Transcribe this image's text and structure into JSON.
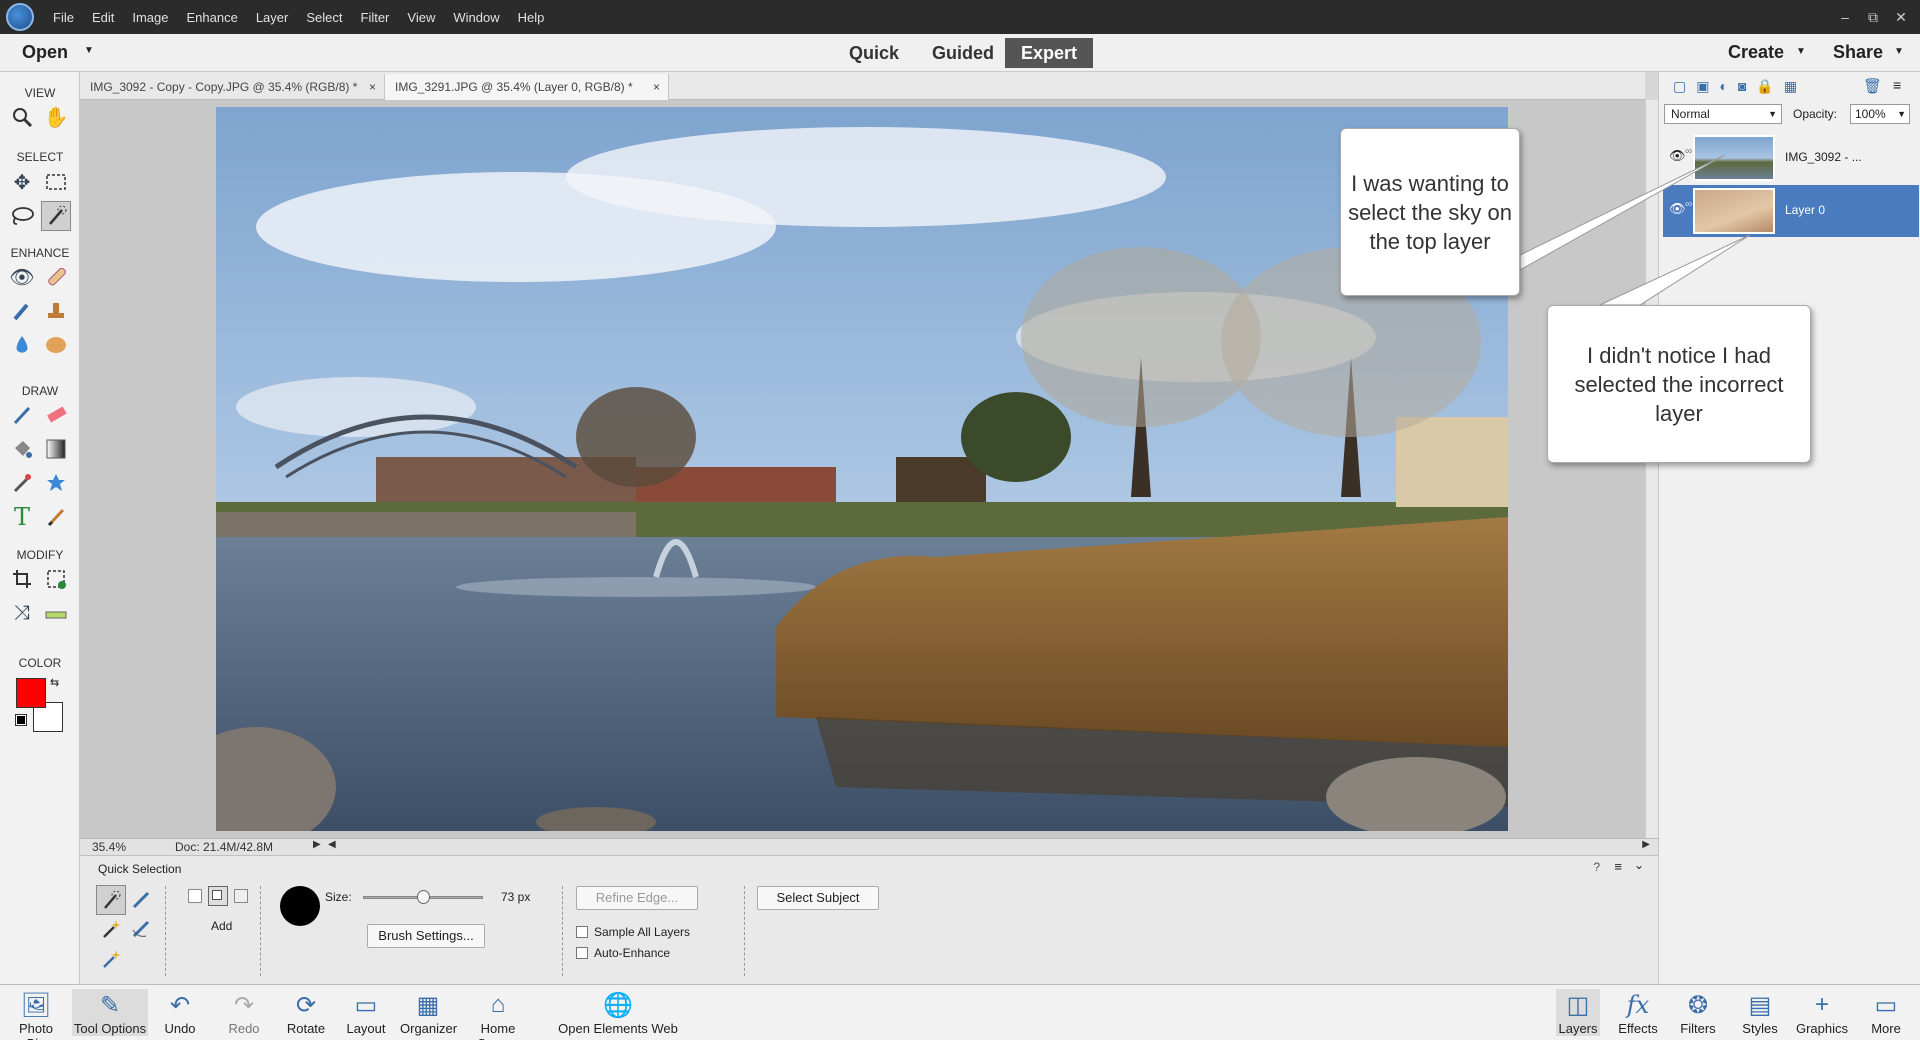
{
  "menubar": {
    "items": [
      "File",
      "Edit",
      "Image",
      "Enhance",
      "Layer",
      "Select",
      "Filter",
      "View",
      "Window",
      "Help"
    ],
    "window_controls": [
      "–",
      "⧉",
      "✕"
    ]
  },
  "modebar": {
    "open_label": "Open",
    "modes": [
      "Quick",
      "Guided",
      "Expert"
    ],
    "active_mode": "Expert",
    "create_label": "Create",
    "share_label": "Share"
  },
  "toolbar": {
    "sections": {
      "view": "VIEW",
      "select": "SELECT",
      "enhance": "ENHANCE",
      "draw": "DRAW",
      "modify": "MODIFY",
      "color": "COLOR"
    },
    "foreground_color": "#ff0000",
    "background_color": "#ffffff"
  },
  "tabs": [
    {
      "label": "IMG_3092 - Copy - Copy.JPG @ 35.4% (RGB/8) *"
    },
    {
      "label": "IMG_3291.JPG @ 35.4% (Layer 0, RGB/8) *"
    }
  ],
  "tab_close": "×",
  "status": {
    "zoom": "35.4%",
    "doc": "Doc: 21.4M/42.8M"
  },
  "callouts": {
    "top": "I was wanting to select the sky on the top layer",
    "bottom": "I didn't notice I had selected the incorrect layer"
  },
  "layers_panel": {
    "blend_mode": "Normal",
    "opacity_label": "Opacity:",
    "opacity_value": "100%",
    "layers": [
      {
        "name": "IMG_3092 - ..."
      },
      {
        "name": "Layer 0"
      }
    ]
  },
  "tool_options": {
    "title": "Quick Selection",
    "add_label": "Add",
    "size_label": "Size:",
    "size_value": "73 px",
    "size_fraction": 0.5,
    "brush_settings_label": "Brush Settings...",
    "refine_edge_label": "Refine Edge...",
    "sample_all_layers_label": "Sample All Layers",
    "auto_enhance_label": "Auto-Enhance",
    "select_subject_label": "Select Subject"
  },
  "bottombar": {
    "left": [
      "Photo Bin",
      "Tool Options",
      "Undo",
      "Redo",
      "Rotate",
      "Layout",
      "Organizer",
      "Home Screen",
      "Open Elements Web"
    ],
    "right": [
      "Layers",
      "Effects",
      "Filters",
      "Styles",
      "Graphics",
      "More"
    ]
  }
}
